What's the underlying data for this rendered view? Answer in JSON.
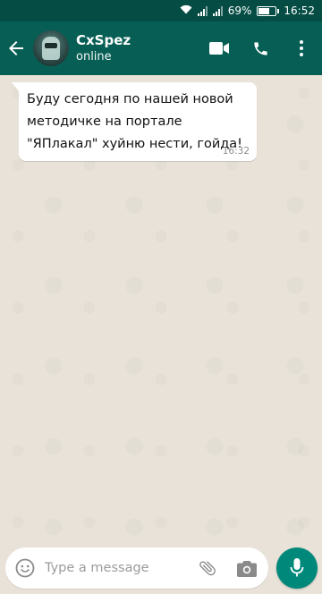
{
  "statusbar": {
    "battery": "69%",
    "battery_level": 0.69,
    "time": "16:52"
  },
  "header": {
    "contact_name": "CxSpez",
    "contact_status": "online"
  },
  "messages": [
    {
      "text": "Буду сегодня по нашей новой методичке на портале \"ЯПлакал\" хуйню нести, гойда!",
      "time": "16:32"
    }
  ],
  "composer": {
    "placeholder": "Type a message"
  },
  "colors": {
    "header": "#075e54",
    "statusbar": "#054d44",
    "accent": "#00897b",
    "chat_bg": "#e8e2d8"
  },
  "icons": [
    "wifi-icon",
    "signal-icon",
    "battery-icon",
    "back-arrow-icon",
    "video-call-icon",
    "phone-icon",
    "emoji-icon",
    "attach-icon",
    "camera-icon",
    "mic-icon"
  ]
}
